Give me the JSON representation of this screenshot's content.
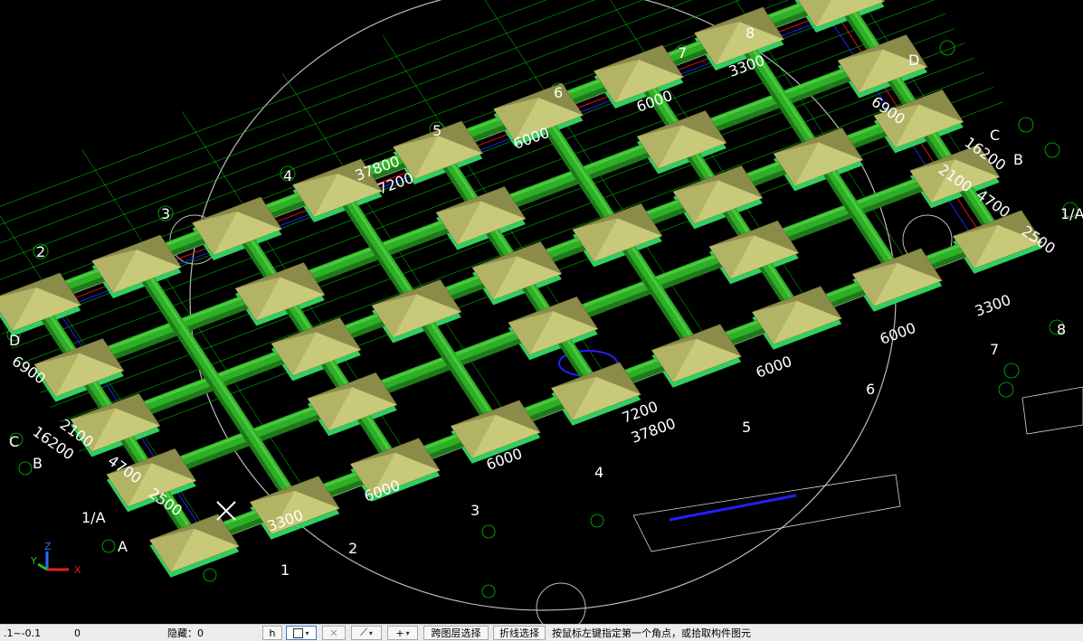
{
  "canvas": {
    "axis_labels": [
      "4",
      "5",
      "6",
      "7",
      "8",
      "D",
      "C",
      "B",
      "1/A"
    ],
    "dims_lower": [
      "6000",
      "7200",
      "6000",
      "3300",
      "6000",
      "37800"
    ],
    "dims_right": [
      "6900",
      "16200",
      "2100",
      "4700",
      "2500"
    ],
    "dims_left": [
      "6900",
      "2100",
      "16200",
      "4700",
      "2500",
      "3300",
      "6000"
    ],
    "dims_top": [
      "37800",
      "7200",
      "6000",
      "6000",
      "3300"
    ],
    "grid_labels_left": [
      "D",
      "C",
      "B",
      "A"
    ],
    "grid_labels_bottom": [
      "1",
      "2",
      "3",
      "4",
      "5",
      "6",
      "7",
      "8"
    ],
    "grid_labels_left_alt": [
      "1/A"
    ],
    "axis_gizmo": {
      "x": "X",
      "y": "Y",
      "z": "Z"
    }
  },
  "statusbar": {
    "coords": ".1~-0.1",
    "zero": "0",
    "hidden_label": "隐藏：0",
    "tool_h": "h",
    "tool_box": "",
    "tool_x": "✕",
    "tool_line": "⟋",
    "tool_plus": "+",
    "cross_layer_select": "跨图层选择",
    "polyline_select": "折线选择",
    "prompt": "按鼠标左键指定第一个角点，或拾取构件图元"
  },
  "colors": {
    "beam_green": "#2fae28",
    "beam_light": "#4fd440",
    "beam_dark": "#1d7a18",
    "footing_top": "#c9c97a",
    "footing_side": "#8c8c4a",
    "footing_base": "#2fd060",
    "cad_green": "#00c000",
    "cad_white": "#d8d8d8",
    "cad_blue": "#2020ff",
    "cad_red": "#e01010",
    "cad_yellow": "#d0d000"
  }
}
